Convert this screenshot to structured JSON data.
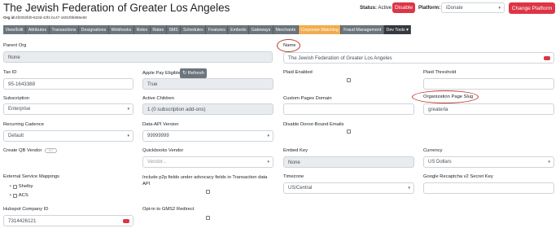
{
  "header": {
    "title": "The Jewish Federation of Greater Los Angeles",
    "org_id_label": "Org id:",
    "org_id_value": "4f2002fd0-823d-43f1-bc47-1601f9b996e60",
    "status_label": "Status:",
    "status_value": "Active",
    "disable_label": "Disable",
    "platform_label": "Platform:",
    "platform_value": "iDonate",
    "change_platform_label": "Change Platform"
  },
  "nav": {
    "tabs": [
      "View/Edit",
      "Attributes",
      "Transactions",
      "Designations",
      "Webhooks",
      "Roles",
      "Rates",
      "SMS",
      "Schedules",
      "Features",
      "Embeds",
      "Gateways",
      "Merchants",
      "Corporate Matching",
      "Fraud Management",
      "Dev Tools"
    ],
    "active_tab": "Corporate Matching",
    "dev_tools_caret": "▾"
  },
  "form": {
    "parent_org": {
      "label": "Parent Org",
      "value": "None"
    },
    "name": {
      "label": "Name",
      "value": "The Jewish Federation of Greater Los Angeles"
    },
    "tax_id": {
      "label": "Tax ID",
      "value": "95-1643388"
    },
    "apple_pay": {
      "label": "Apple Pay Eligible",
      "refresh_label": "Refresh",
      "value": "True"
    },
    "plaid_enabled": {
      "label": "Plaid Enabled"
    },
    "plaid_threshold": {
      "label": "Plaid Threshold",
      "value": ""
    },
    "subscription": {
      "label": "Subscription",
      "value": "Enterprise"
    },
    "active_children": {
      "label": "Active Children",
      "value": "1 (0 subscription add-ons)"
    },
    "custom_pages_domain": {
      "label": "Custom Pages Domain",
      "value": ""
    },
    "org_page_slug": {
      "label": "Organization Page Slug",
      "value": "greaterla"
    },
    "recurring_cadence": {
      "label": "Recurring Cadence",
      "value": "Default"
    },
    "data_api_version": {
      "label": "Data-API Version",
      "value": "99999999"
    },
    "disable_donor_bound": {
      "label": "Disable Donor-Bound Emails"
    },
    "create_qb_vendor": {
      "label": "Create QB Vendor",
      "toggle_text": "NO"
    },
    "quickbooks_vendor": {
      "label": "Quickbooks Vendor",
      "placeholder": "Vendor..."
    },
    "embed_key": {
      "label": "Embed Key",
      "value": "None"
    },
    "currency": {
      "label": "Currency",
      "value": "US Dollars"
    },
    "external_service_mappings": {
      "label": "External Service Mappings",
      "items": [
        "Shelby",
        "ACS"
      ]
    },
    "p2p_fields": {
      "label": "Include p2p fields under advocacy fields in Transaction data API"
    },
    "timezone": {
      "label": "Timezone",
      "value": "US/Central"
    },
    "recaptcha": {
      "label": "Google Recaptcha v2 Secret Key",
      "value": ""
    },
    "hubspot_company_id": {
      "label": "Hubspot Company ID",
      "value": "7314426121"
    },
    "opt_in_gms2": {
      "label": "Opt-in to GMS2 Redirect"
    }
  },
  "colors": {
    "accent_red": "#dc3545",
    "nav_bg": "#6c757d",
    "active_tab": "#f0ad4e",
    "annotation": "#c0392b"
  }
}
